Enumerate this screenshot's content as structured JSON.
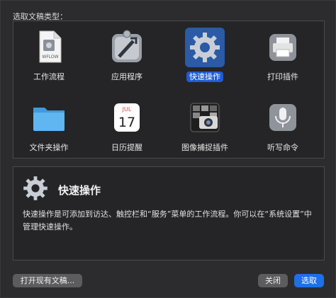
{
  "dialog": {
    "heading": "选取文稿类型：",
    "doc_types": [
      {
        "label": "工作流程",
        "icon": "workflow-document-icon",
        "icon_text": "WFLOW"
      },
      {
        "label": "应用程序",
        "icon": "application-icon"
      },
      {
        "label": "快速操作",
        "icon": "gear-icon",
        "selected": true
      },
      {
        "label": "打印插件",
        "icon": "printer-icon"
      },
      {
        "label": "文件夹操作",
        "icon": "folder-icon"
      },
      {
        "label": "日历提醒",
        "icon": "calendar-icon",
        "icon_month": "JUL",
        "icon_day": "17"
      },
      {
        "label": "图像捕捉插件",
        "icon": "image-capture-icon"
      },
      {
        "label": "听写命令",
        "icon": "microphone-icon"
      }
    ],
    "description": {
      "title": "快速操作",
      "text": "快速操作是可添加到访达、触控栏和“服务”菜单的工作流程。你可以在“系统设置”中管理快速操作。"
    },
    "buttons": {
      "open_existing": "打开现有文稿...",
      "close": "关闭",
      "choose": "选取"
    }
  },
  "colors": {
    "accent": "#1f6fe5",
    "selection": "#2b5aa6",
    "background": "#2c2c2e"
  }
}
